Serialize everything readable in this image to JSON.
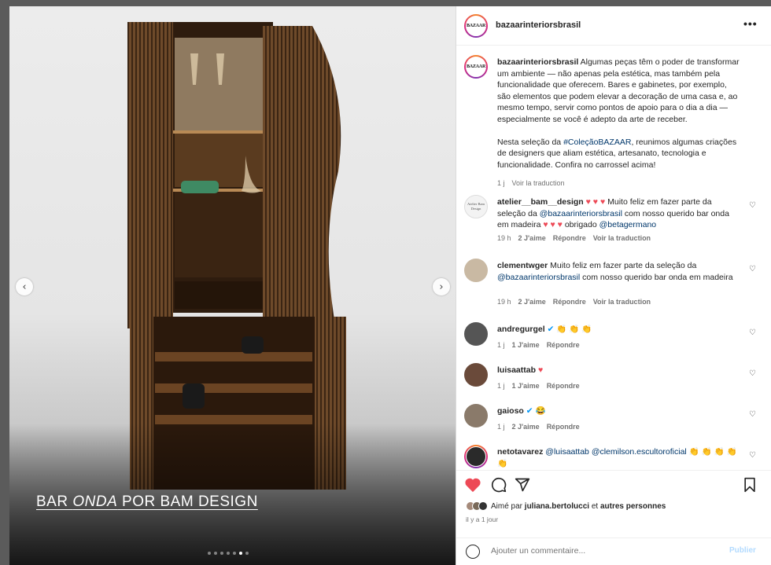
{
  "post": {
    "caption_overlay": "BAR ONDA POR BAM DESIGN",
    "caption_parts": {
      "a": "BAR ",
      "b": "ONDA",
      "c": " POR BAM DESIGN"
    },
    "carousel_dots": 7,
    "carousel_active": 5
  },
  "header": {
    "username": "bazaarinteriorsbrasil",
    "avatar_text": "BAZAAR",
    "more": "•••"
  },
  "main_comment": {
    "username": "bazaarinteriorsbrasil",
    "p1": " Algumas peças têm o poder de transformar um ambiente — não apenas pela estética, mas também pela funcionalidade que oferecem. Bares e gabinetes, por exemplo, são elementos que podem elevar a decoração de uma casa e, ao mesmo tempo, servir como pontos de apoio para o dia a dia — especialmente se você é adepto da arte de receber.",
    "p2_a": "Nesta seleção da ",
    "p2_tag": "#ColeçãoBAZAAR",
    "p2_b": ", reunimos algumas criações de designers que aliam estética, artesanato, tecnologia e funcionalidade. Confira no carrossel acima!",
    "time": "1 j",
    "translate": "Voir la traduction"
  },
  "comments": [
    {
      "username": "atelier__bam__design",
      "text_a": " ",
      "hearts1": "♥ ♥ ♥",
      "text_b": " Muito feliz em fazer parte da seleção da ",
      "mention": "@bazaarinteriorsbrasil",
      "text_c": " com nosso querido bar onda em madeira ",
      "hearts2": "♥ ♥ ♥",
      "text_d": " obrigado ",
      "mention2": "@betagermano",
      "time": "19 h",
      "likes": "2 J'aime",
      "reply": "Répondre",
      "translate": "Voir la traduction",
      "avatar_text": "Atelier Bam Design"
    },
    {
      "username": "clementwger",
      "text_a": " Muito feliz em fazer parte da seleção da ",
      "mention": "@bazaarinteriorsbrasil",
      "text_b": " com nosso querido bar onda em madeira",
      "time": "19 h",
      "likes": "2 J'aime",
      "reply": "Répondre",
      "translate": "Voir la traduction"
    },
    {
      "username": "andregurgel",
      "emoji": "👏 👏 👏",
      "time": "1 j",
      "likes": "1 J'aime",
      "reply": "Répondre"
    },
    {
      "username": "luisaattab",
      "emoji": "♥",
      "time": "1 j",
      "likes": "1 J'aime",
      "reply": "Répondre"
    },
    {
      "username": "gaioso",
      "emoji": "😂",
      "time": "1 j",
      "likes": "2 J'aime",
      "reply": "Répondre"
    },
    {
      "username": "netotavarez",
      "mention": "@luisaattab",
      "mention2": "@clemilson.escultoroficial",
      "emoji": "👏 👏 👏 👏 👏"
    }
  ],
  "likes_line": {
    "prefix": "Aimé par ",
    "user": "juliana.bertolucci",
    "mid": " et ",
    "rest": "autres personnes"
  },
  "timestamp": "il y a 1 jour",
  "add_comment": {
    "placeholder": "Ajouter un commentaire...",
    "publish": "Publier"
  },
  "colors": {
    "like_red": "#ed4956",
    "link": "#00376b",
    "verified": "#0095f6"
  }
}
